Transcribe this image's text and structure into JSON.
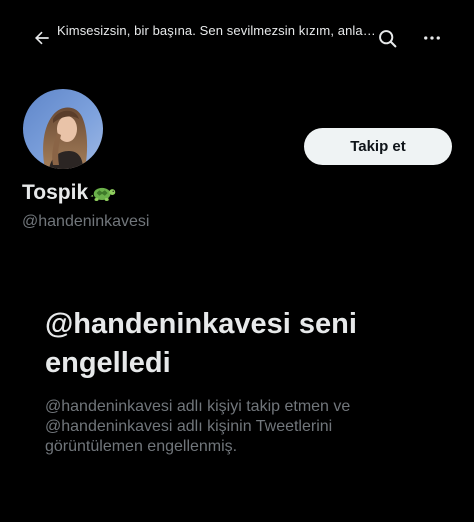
{
  "header": {
    "back_icon": "arrow-left-icon",
    "title": "Kimsesizsin, bir başına. Sen sevilmezsin kızım, anlasana...",
    "search_icon": "search-icon",
    "more_icon": "more-horizontal-icon"
  },
  "profile": {
    "display_name": "Tospik",
    "name_emoji": "turtle-icon",
    "handle": "@handeninkavesi",
    "follow_label": "Takip et"
  },
  "blocked": {
    "title": "@handeninkavesi seni engelledi",
    "description": "@handeninkavesi adlı kişiyi takip etmen ve @handeninkavesi adlı kişinin Tweetlerini görüntülemen engellenmiş."
  },
  "colors": {
    "background": "#000000",
    "primary_text": "#e7e9ea",
    "secondary_text": "#71767b",
    "button_bg": "#eff3f4",
    "button_text": "#0f1419"
  }
}
